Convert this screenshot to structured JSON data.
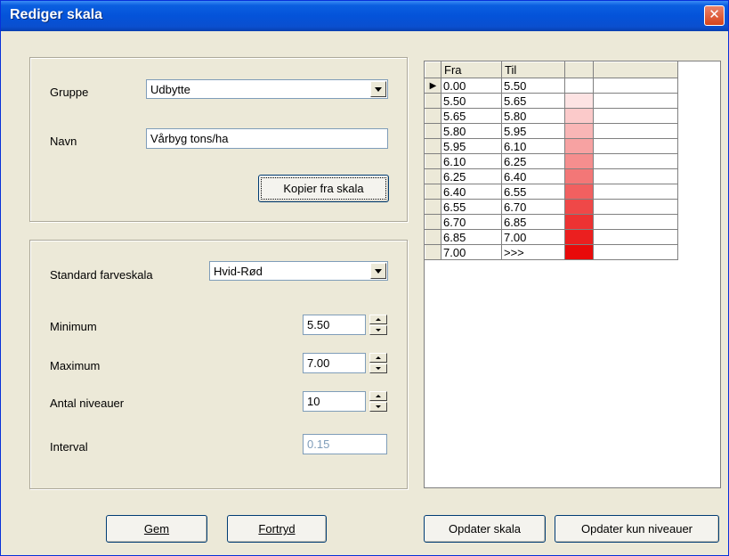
{
  "window": {
    "title": "Rediger skala"
  },
  "group": {
    "label": "Gruppe",
    "value": "Udbytte"
  },
  "name": {
    "label": "Navn",
    "value": "Vårbyg tons/ha"
  },
  "copy_button": "Kopier fra skala",
  "standard_scale": {
    "label": "Standard farveskala",
    "value": "Hvid-Rød"
  },
  "minimum": {
    "label": "Minimum",
    "value": "5.50"
  },
  "maximum": {
    "label": "Maximum",
    "value": "7.00"
  },
  "levels": {
    "label": "Antal niveauer",
    "value": "10"
  },
  "interval": {
    "label": "Interval",
    "value": "0.15"
  },
  "buttons": {
    "save": "Gem",
    "undo": "Fortryd",
    "update_scale": "Opdater skala",
    "update_levels": "Opdater kun niveauer"
  },
  "grid": {
    "headers": {
      "fra": "Fra",
      "til": "Til"
    },
    "current_row_marker": "▶",
    "rows": [
      {
        "fra": "0.00",
        "til": "5.50",
        "color": "#ffffff"
      },
      {
        "fra": "5.50",
        "til": "5.65",
        "color": "#fde3e3"
      },
      {
        "fra": "5.65",
        "til": "5.80",
        "color": "#fbcaca"
      },
      {
        "fra": "5.80",
        "til": "5.95",
        "color": "#f9b6b6"
      },
      {
        "fra": "5.95",
        "til": "6.10",
        "color": "#f7a2a2"
      },
      {
        "fra": "6.10",
        "til": "6.25",
        "color": "#f58e8e"
      },
      {
        "fra": "6.25",
        "til": "6.40",
        "color": "#f37777"
      },
      {
        "fra": "6.40",
        "til": "6.55",
        "color": "#f16060"
      },
      {
        "fra": "6.55",
        "til": "6.70",
        "color": "#ef4848"
      },
      {
        "fra": "6.70",
        "til": "6.85",
        "color": "#ed3232"
      },
      {
        "fra": "6.85",
        "til": "7.00",
        "color": "#eb1f1f"
      },
      {
        "fra": "7.00",
        "til": ">>>",
        "color": "#e80a0a"
      }
    ]
  }
}
